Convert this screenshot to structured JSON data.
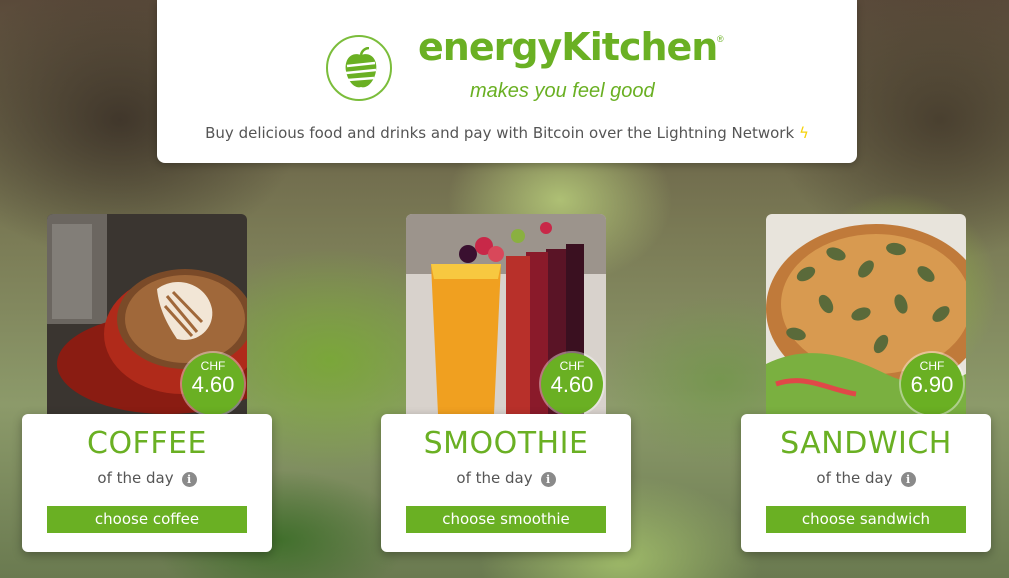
{
  "header": {
    "brand": "energyKitchen",
    "registered": "®",
    "tagline": "makes you feel good",
    "subtitle": "Buy delicious food and drinks and pay with Bitcoin over the Lightning Network",
    "bolt": "ϟ"
  },
  "colors": {
    "accent": "#6ab023",
    "card_bg": "#ffffff",
    "text": "#555555",
    "bolt": "#f5d20a"
  },
  "products": [
    {
      "name": "COFFEE",
      "subtitle": "of the day",
      "currency": "CHF",
      "price": "4.60",
      "button": "choose coffee",
      "image_icon": "coffee-cup-latte-art"
    },
    {
      "name": "SMOOTHIE",
      "subtitle": "of the day",
      "currency": "CHF",
      "price": "4.60",
      "button": "choose smoothie",
      "image_icon": "smoothie-glasses-berries"
    },
    {
      "name": "SANDWICH",
      "subtitle": "of the day",
      "currency": "CHF",
      "price": "6.90",
      "button": "choose sandwich",
      "image_icon": "seeded-bread-sandwich"
    }
  ],
  "info_icon_glyph": "i"
}
